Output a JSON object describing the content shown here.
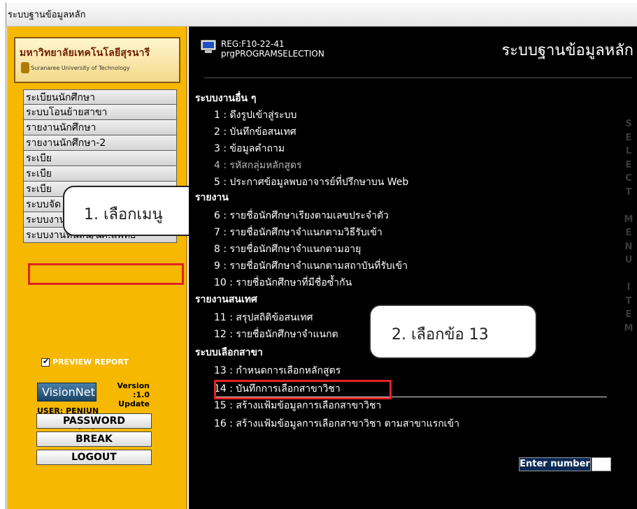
{
  "window": {
    "title": "ระบบฐานข้อมูลหลัก"
  },
  "sidebar": {
    "logo_th": "มหาวิทยาลัยเทคโนโลยีสุรนารี",
    "logo_en": "Suranaree University of Technology",
    "menu_items": [
      "ระเบียนนักศึกษา",
      "ระบบโอนย้ายสาขา",
      "รายงานนักศึกษา",
      "รายงานนักศึกษา-2",
      "ระเบีย",
      "ระเบีย",
      "ระเบีย",
      "ระบบจัด กำนักศึกษาใหม่",
      "ระบบงานอื่น ๆ",
      "ระบบงานหนี้สิน/นศ.แพทย์"
    ],
    "callout": "1. เลือกเมนู",
    "preview_label": "PREVIEW REPORT",
    "preview_checked": true,
    "visionnet_label": "VisionNet",
    "version_label": "Version :1.0",
    "update_label": "Update",
    "user_label": "USER: PENJUN",
    "since_label": "SINCE: 17/10/57 13:28",
    "buttons": {
      "password": "PASSWORD",
      "break": "BREAK",
      "logout": "LOGOUT"
    }
  },
  "main": {
    "reg_code": "REG:F10-22-41",
    "program_name": "prgPROGRAMSELECTION",
    "title": "ระบบฐานข้อมูลหลัก",
    "sections": {
      "other": "ระบบงานอื่น ๆ",
      "report": "รายงาน",
      "info_report": "รายงานสนเทศ",
      "major_select": "ระบบเลือกสาขา"
    },
    "options": [
      "1 : ดึงรูปเข้าสู่ระบบ",
      "2 : บันทึกข้อสนเทศ",
      "3 : ข้อมูลคำถาม",
      "4 : รหัสกลุ่มหลักสูตร",
      "5 : ประกาศข้อมูลพบอาจารย์ที่ปรึกษาบน Web",
      "6 : รายชื่อนักศึกษาเรียงตามเลขประจำตัว",
      "7 : รายชื่อนักศึกษาจำแนกตามวิธีรับเข้า",
      "8 : รายชื่อนักศึกษาจำแนกตามอายุ",
      "9 : รายชื่อนักศึกษาจำแนกตามสถาบันที่รับเข้า",
      "10 : รายชื่อนักศึกษาที่มีชื่อซ้ำกัน",
      "11 : สรุปสถิติข้อสนเทศ",
      "12 : รายชื่อนักศึกษาจำแนกต",
      "13 : กำหนดการเลือกหลักสูตร",
      "14 : บันทึกการเลือกสาขาวิชา",
      "15 : สร้างแฟ้มข้อมูลการเลือกสาขาวิชา",
      "16 : สร้างแฟ้มข้อมูลการเลือกสาขาวิชา  ตามสาขาแรกเข้า"
    ],
    "callout": "2. เลือกข้อ 13",
    "side_text": "S E L E C T  M E N U  I T E M",
    "enter_label": "Enter number",
    "enter_value": ""
  }
}
